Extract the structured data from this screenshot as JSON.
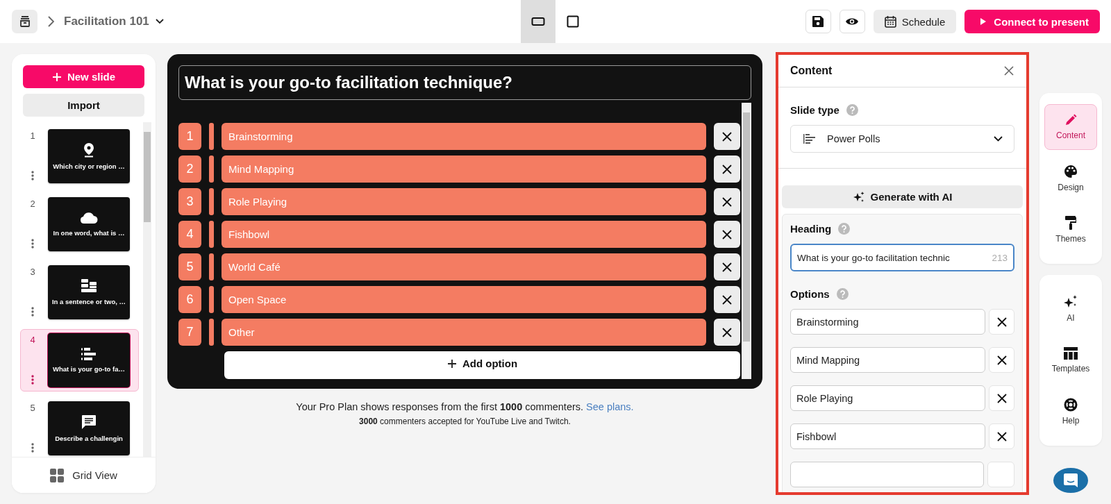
{
  "top_bar": {
    "project_title": "Facilitation 101",
    "view_toggles": [
      {
        "kind": "wide",
        "selected": true
      },
      {
        "kind": "square",
        "selected": false
      }
    ],
    "schedule": "Schedule",
    "connect": "Connect to present"
  },
  "slide_list": {
    "new_slide": "New slide",
    "import": "Import",
    "slides": [
      {
        "number": "1",
        "kind": "pin",
        "title": "Which city or region …",
        "selected": false
      },
      {
        "number": "2",
        "kind": "cloud",
        "title": "In one word, what is …",
        "selected": false
      },
      {
        "number": "3",
        "kind": "blocks",
        "title": "In a sentence or two, …",
        "selected": false
      },
      {
        "number": "4",
        "kind": "bars",
        "title": "What is your go-to fa…",
        "selected": true
      },
      {
        "number": "5",
        "kind": "chat",
        "title": "Describe a challengin",
        "selected": false
      }
    ],
    "grid_view": "Grid View"
  },
  "editor": {
    "heading": "What is your go-to facilitation technique?",
    "options": [
      {
        "number": "1",
        "label": "Brainstorming"
      },
      {
        "number": "2",
        "label": "Mind Mapping"
      },
      {
        "number": "3",
        "label": "Role Playing"
      },
      {
        "number": "4",
        "label": "Fishbowl"
      },
      {
        "number": "5",
        "label": "World Café"
      },
      {
        "number": "6",
        "label": "Open Space"
      },
      {
        "number": "7",
        "label": "Other"
      }
    ],
    "add_option": "Add option"
  },
  "plan_note": {
    "line_1": "Your Pro Plan shows responses from the first **1000** commenters.",
    "link": "See plans.",
    "line_2": "**3000** commenters accepted for YouTube Live and Twitch."
  },
  "content_panel": {
    "title": "Content",
    "slide_type_label": "Slide type",
    "slide_type": "Power Polls",
    "generate": "Generate with AI",
    "heading_label": "Heading",
    "heading_value": "What is your go-to facilitation technic",
    "heading_count": "213",
    "options_label": "Options",
    "options": [
      "Brainstorming",
      "Mind Mapping",
      "Role Playing",
      "Fishbowl"
    ]
  },
  "side_tools": [
    [
      {
        "label": "Content",
        "kind": "pencil",
        "selected": true
      },
      {
        "label": "Design",
        "kind": "palette",
        "selected": false
      },
      {
        "label": "Themes",
        "kind": "roller",
        "selected": false
      }
    ],
    [
      {
        "label": "AI",
        "kind": "sparkles",
        "selected": false
      },
      {
        "label": "Templates",
        "kind": "templates",
        "selected": false
      },
      {
        "label": "Help",
        "kind": "lifebuoy",
        "selected": false
      }
    ]
  ]
}
